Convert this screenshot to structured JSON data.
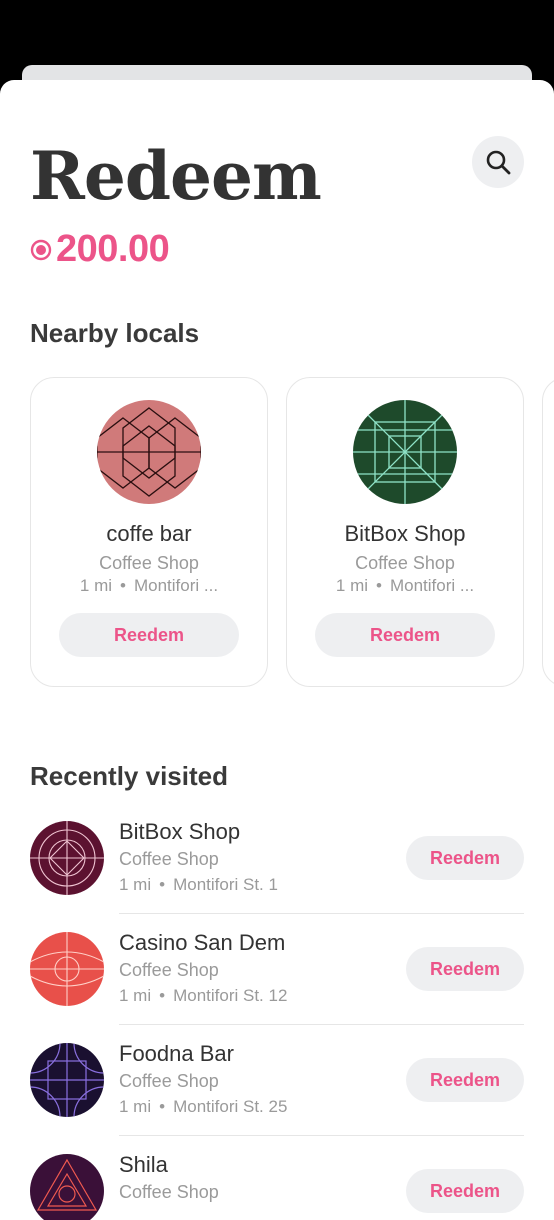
{
  "header": {
    "title": "Redeem",
    "balance": "200.00",
    "coin_icon": "coin-icon",
    "search_icon": "search-icon"
  },
  "nearby": {
    "title": "Nearby locals",
    "items": [
      {
        "name": "coffe bar",
        "type": "Coffee Shop",
        "distance": "1 mi",
        "address": "Montifori ...",
        "button": "Reedem",
        "logo_color": "#d07a7a"
      },
      {
        "name": "BitBox Shop",
        "type": "Coffee Shop",
        "distance": "1 mi",
        "address": "Montifori ...",
        "button": "Reedem",
        "logo_color": "#1e4a2b"
      }
    ]
  },
  "recent": {
    "title": "Recently visited",
    "items": [
      {
        "name": "BitBox Shop",
        "type": "Coffee Shop",
        "distance": "1 mi",
        "address": "Montifori St. 1",
        "button": "Reedem",
        "logo_color": "#5c1230"
      },
      {
        "name": "Casino San Dem",
        "type": "Coffee Shop",
        "distance": "1 mi",
        "address": "Montifori St. 12",
        "button": "Reedem",
        "logo_color": "#e8504a"
      },
      {
        "name": "Foodna Bar",
        "type": "Coffee Shop",
        "distance": "1 mi",
        "address": "Montifori St. 25",
        "button": "Reedem",
        "logo_color": "#1a1030"
      },
      {
        "name": "Shila",
        "type": "Coffee Shop",
        "distance": "",
        "address": "",
        "button": "Reedem",
        "logo_color": "#3a1038"
      }
    ]
  },
  "colors": {
    "accent": "#ec5489",
    "text": "#333333",
    "muted": "#9a9a9a",
    "button_bg": "#eeeff1"
  }
}
